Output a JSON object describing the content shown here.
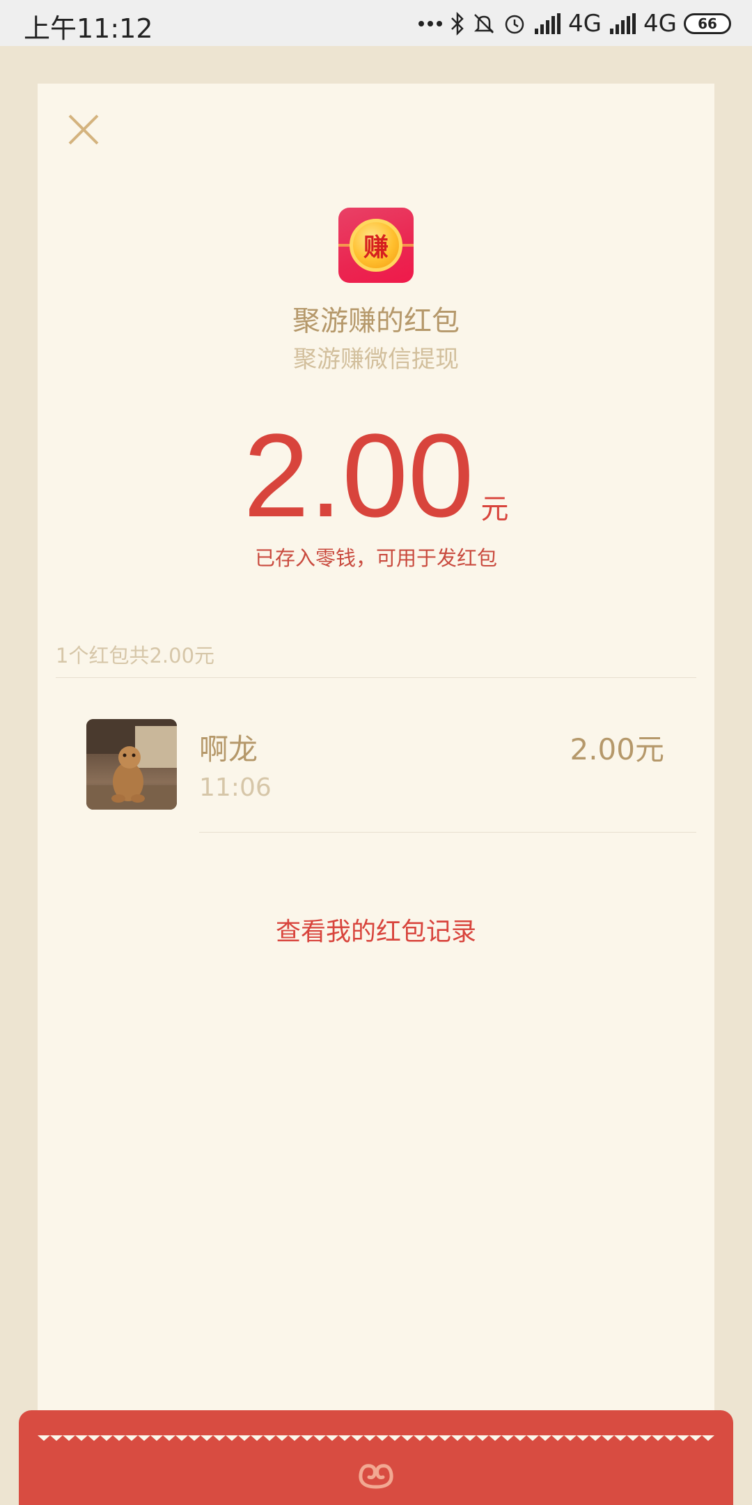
{
  "status_bar": {
    "time": "上午11:12",
    "network_1": "4G",
    "network_2": "4G",
    "battery": "66"
  },
  "header": {
    "title": "聚游赚的红包",
    "subtitle": "聚游赚微信提现",
    "app_icon_char": "赚"
  },
  "amount": {
    "value": "2.00",
    "unit": "元",
    "note": "已存入零钱，可用于发红包"
  },
  "summary": "1个红包共2.00元",
  "recipients": [
    {
      "name": "啊龙",
      "time": "11:06",
      "amount": "2.00元"
    }
  ],
  "records_link": "查看我的红包记录",
  "colors": {
    "accent_red": "#d8443c",
    "gold_text": "#b5986a",
    "card_bg": "#fbf6ea",
    "page_bg": "#ede4d1"
  },
  "icons": [
    "close-icon",
    "bluetooth-icon",
    "mute-icon",
    "alarm-icon",
    "signal-icon",
    "battery-icon",
    "red-packet-logo-icon"
  ]
}
